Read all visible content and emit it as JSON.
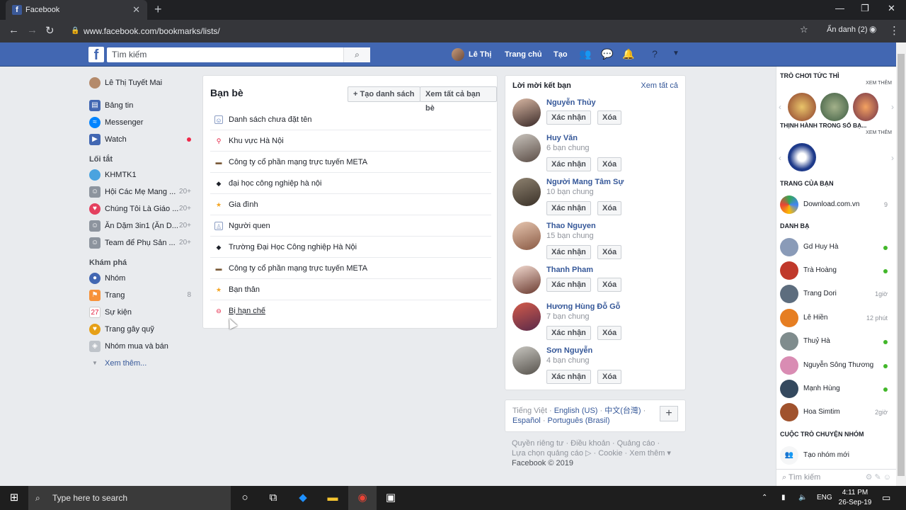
{
  "browser": {
    "tab_title": "Facebook",
    "url": "www.facebook.com/bookmarks/lists/",
    "incognito_label": "Ẩn danh (2)"
  },
  "fb_header": {
    "search_placeholder": "Tìm kiếm",
    "profile_name": "Lê Thị",
    "home": "Trang chủ",
    "create": "Tạo"
  },
  "left_nav": {
    "user": "Lê Thị Tuyết Mai",
    "main": [
      {
        "label": "Bảng tin",
        "color": "#4267b2"
      },
      {
        "label": "Messenger",
        "color": "#0084ff"
      },
      {
        "label": "Watch",
        "color": "#4267b2"
      }
    ],
    "shortcuts_heading": "Lối tắt",
    "shortcuts": [
      {
        "label": "KHMTK1",
        "count": ""
      },
      {
        "label": "Hội Các Mẹ Mang ...",
        "count": "20+"
      },
      {
        "label": "Chúng Tôi Là Giáo ...",
        "count": "20+"
      },
      {
        "label": "Ăn Dặm 3in1 (Ăn D...",
        "count": "20+"
      },
      {
        "label": "Team để Phụ Sản ...",
        "count": "20+"
      }
    ],
    "explore_heading": "Khám phá",
    "explore": [
      {
        "label": "Nhóm",
        "count": ""
      },
      {
        "label": "Trang",
        "count": "8"
      },
      {
        "label": "Sự kiện",
        "count": ""
      },
      {
        "label": "Trang gây quỹ",
        "count": ""
      },
      {
        "label": "Nhóm mua và bán",
        "count": ""
      }
    ],
    "see_more": "Xem thêm..."
  },
  "friends_panel": {
    "title": "Bạn bè",
    "create_list": "Tạo danh sách",
    "see_all_friends": "Xem tất cả bạn bè",
    "lists": [
      "Danh sách chưa đặt tên",
      "Khu vực Hà Nội",
      "Công ty cổ phần mạng trực tuyến META",
      "đại học công nghiệp hà nội",
      "Gia đình",
      "Người quen",
      "Trường Đại Học Công nghiệp Hà Nội",
      "Công ty cổ phần mạng trực tuyến META",
      "Bạn thân",
      "Bị hạn chế"
    ]
  },
  "friend_requests": {
    "title": "Lời mời kết bạn",
    "see_all": "Xem tất cả",
    "confirm": "Xác nhận",
    "delete": "Xóa",
    "items": [
      {
        "name": "Nguyễn Thủy",
        "mutual": ""
      },
      {
        "name": "Huy Văn",
        "mutual": "6 bạn chung"
      },
      {
        "name": "Người Mang Tâm Sự",
        "mutual": "10 bạn chung"
      },
      {
        "name": "Thao Nguyen",
        "mutual": "15 bạn chung"
      },
      {
        "name": "Thanh Pham",
        "mutual": ""
      },
      {
        "name": "Hương Hùng Đỗ Gỗ",
        "mutual": "7 bạn chung"
      },
      {
        "name": "Sơn Nguyễn",
        "mutual": "4 bạn chung"
      }
    ]
  },
  "languages": {
    "current": "Tiếng Việt",
    "others": [
      "English (US)",
      "中文(台灣)",
      "Español",
      "Português (Brasil)"
    ]
  },
  "footer": {
    "line1": "Quyền riêng tư · Điều khoản · Quảng cáo ·",
    "line2": "Lựa chọn quảng cáo ▷ · Cookie · Xem thêm ▾",
    "copyright": "Facebook © 2019"
  },
  "right_sidebar": {
    "games_heading": "TRÒ CHƠI TỨC THÌ",
    "see_more": "XEM THÊM",
    "trending_heading": "THỊNH HÀNH TRONG SỐ BẠ...",
    "pages_heading": "TRANG CỦA BẠN",
    "page_name": "Download.com.vn",
    "page_count": "9",
    "contacts_heading": "DANH BẠ",
    "contacts": [
      {
        "name": "Gd Huy Hà",
        "status": "online",
        "time": ""
      },
      {
        "name": "Trà Hoàng",
        "status": "online",
        "time": ""
      },
      {
        "name": "Trang Dori",
        "status": "time",
        "time": "1giờ"
      },
      {
        "name": "Lê Hiền",
        "status": "time",
        "time": "12 phút"
      },
      {
        "name": "Thuỷ Hà",
        "status": "online",
        "time": ""
      },
      {
        "name": "Nguyễn Sông Thương",
        "status": "online",
        "time": ""
      },
      {
        "name": "Mạnh Hùng",
        "status": "online",
        "time": ""
      },
      {
        "name": "Hoa Simtim",
        "status": "time",
        "time": "2giờ"
      }
    ],
    "group_heading": "CUỘC TRÒ CHUYỆN NHÓM",
    "new_group": "Tạo nhóm mới",
    "search": "Tìm kiếm"
  },
  "taskbar": {
    "search": "Type here to search",
    "lang": "ENG",
    "time": "4:11 PM",
    "date": "26-Sep-19"
  }
}
